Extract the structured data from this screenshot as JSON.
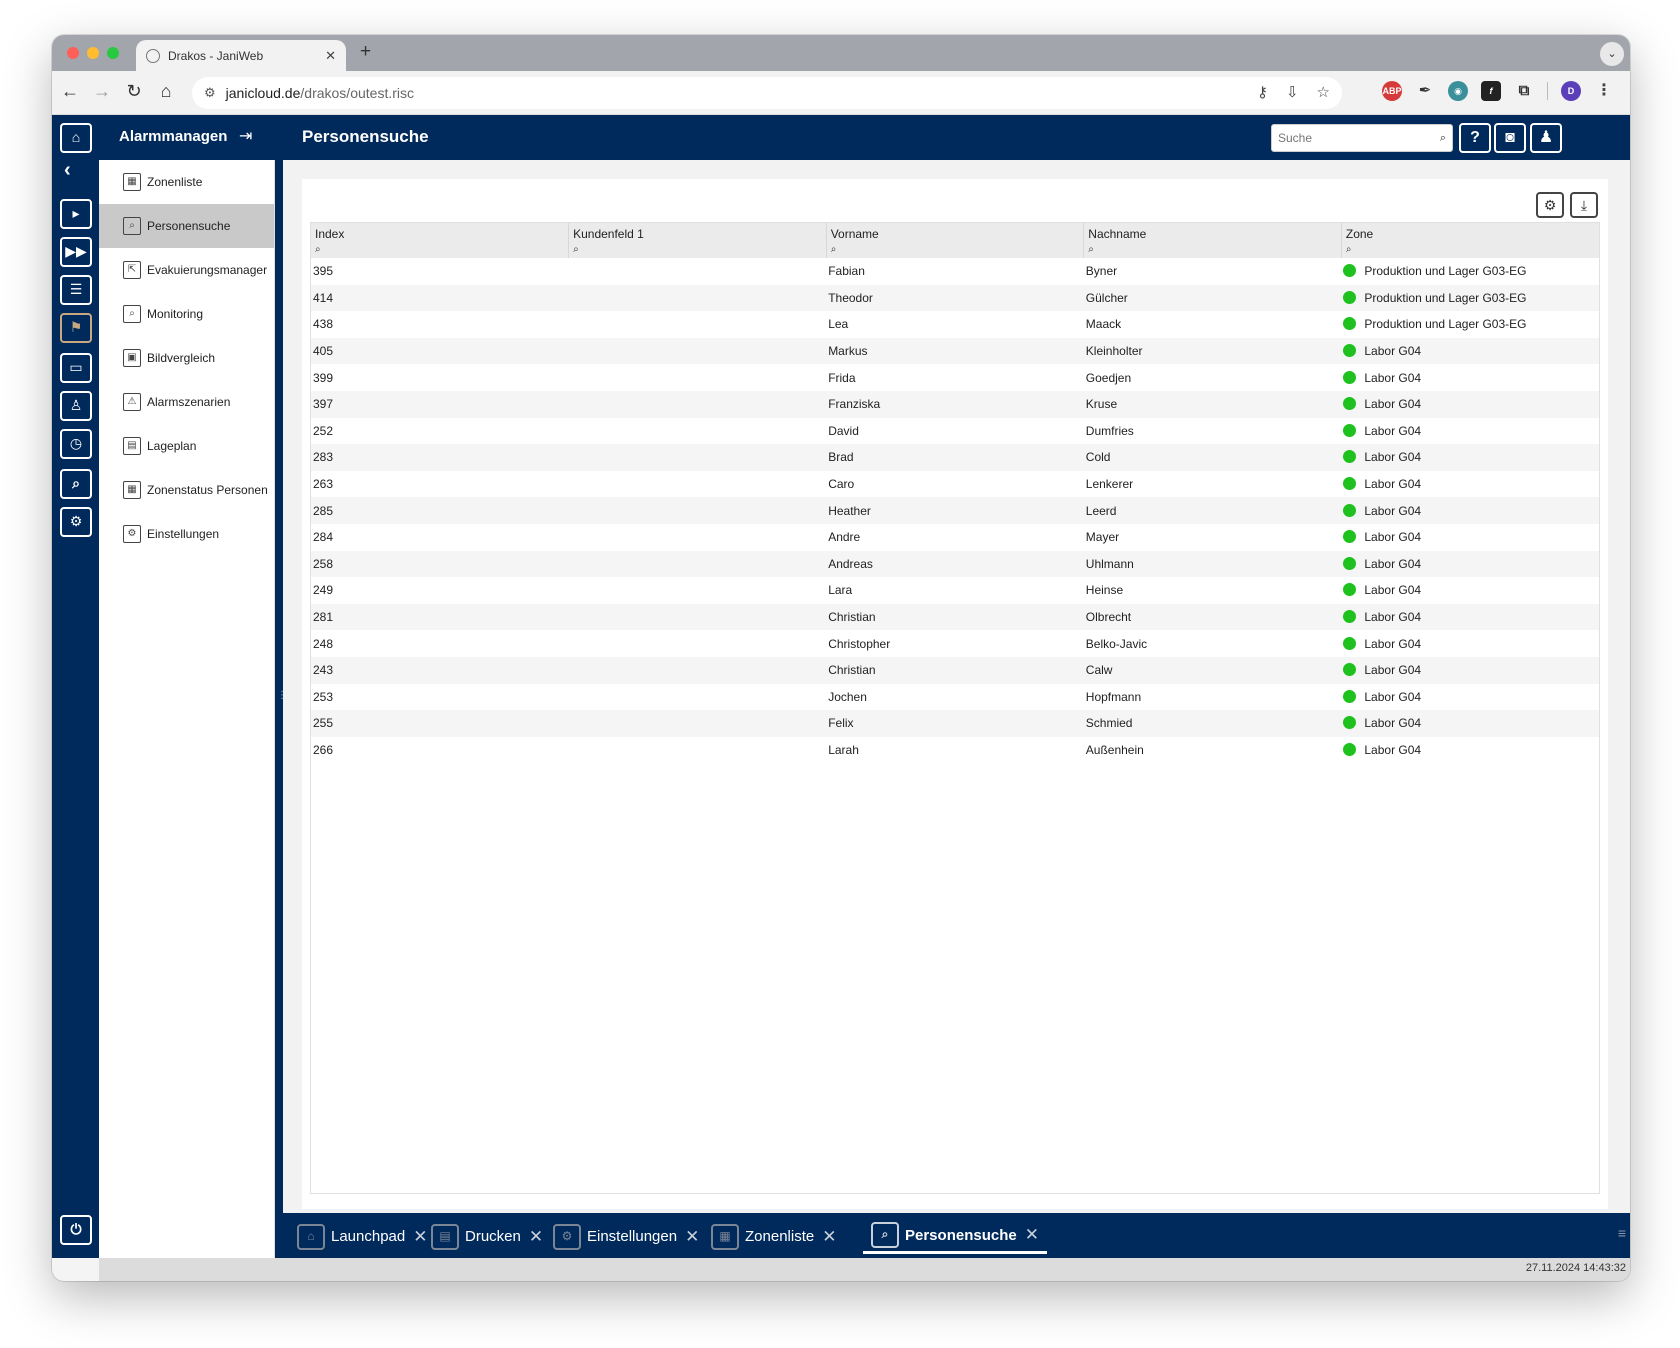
{
  "browser": {
    "tab_title": "Drakos - JaniWeb",
    "url_host": "janicloud.de",
    "url_path": "/drakos/outest.risc",
    "colors": {
      "tabstrip": "#a3a5ad",
      "toolbar": "#f2f2f2"
    }
  },
  "app": {
    "module_title": "Alarmmanagen",
    "page_title": "Personensuche",
    "search_placeholder": "Suche",
    "colors": {
      "primary": "#002a5c",
      "status_green": "#1fc11f",
      "active_row": "#c9c9c9"
    }
  },
  "submenu": {
    "items": [
      {
        "label": "Zonenliste",
        "icon": "grid-icon"
      },
      {
        "label": "Personensuche",
        "icon": "person-search-icon"
      },
      {
        "label": "Evakuierungsmanager",
        "icon": "evacuation-icon"
      },
      {
        "label": "Monitoring",
        "icon": "monitoring-icon"
      },
      {
        "label": "Bildvergleich",
        "icon": "image-compare-icon"
      },
      {
        "label": "Alarmszenarien",
        "icon": "warning-icon"
      },
      {
        "label": "Lageplan",
        "icon": "map-icon"
      },
      {
        "label": "Zonenstatus Personen",
        "icon": "grid-icon"
      },
      {
        "label": "Einstellungen",
        "icon": "gear-icon"
      }
    ]
  },
  "table": {
    "columns": [
      "Index",
      "Kundenfeld 1",
      "Vorname",
      "Nachname",
      "Zone"
    ],
    "rows": [
      {
        "index": "395",
        "kundenfeld": "",
        "vorname": "Fabian",
        "nachname": "Byner",
        "zone": "Produktion und Lager G03-EG"
      },
      {
        "index": "414",
        "kundenfeld": "",
        "vorname": "Theodor",
        "nachname": "Gülcher",
        "zone": "Produktion und Lager G03-EG"
      },
      {
        "index": "438",
        "kundenfeld": "",
        "vorname": "Lea",
        "nachname": "Maack",
        "zone": "Produktion und Lager G03-EG"
      },
      {
        "index": "405",
        "kundenfeld": "",
        "vorname": "Markus",
        "nachname": "Kleinholter",
        "zone": "Labor G04"
      },
      {
        "index": "399",
        "kundenfeld": "",
        "vorname": "Frida",
        "nachname": "Goedjen",
        "zone": "Labor G04"
      },
      {
        "index": "397",
        "kundenfeld": "",
        "vorname": "Franziska",
        "nachname": "Kruse",
        "zone": "Labor G04"
      },
      {
        "index": "252",
        "kundenfeld": "",
        "vorname": "David",
        "nachname": "Dumfries",
        "zone": "Labor G04"
      },
      {
        "index": "283",
        "kundenfeld": "",
        "vorname": "Brad",
        "nachname": "Cold",
        "zone": "Labor G04"
      },
      {
        "index": "263",
        "kundenfeld": "",
        "vorname": "Caro",
        "nachname": "Lenkerer",
        "zone": "Labor G04"
      },
      {
        "index": "285",
        "kundenfeld": "",
        "vorname": "Heather",
        "nachname": "Leerd",
        "zone": "Labor G04"
      },
      {
        "index": "284",
        "kundenfeld": "",
        "vorname": "Andre",
        "nachname": "Mayer",
        "zone": "Labor G04"
      },
      {
        "index": "258",
        "kundenfeld": "",
        "vorname": "Andreas",
        "nachname": "Uhlmann",
        "zone": "Labor G04"
      },
      {
        "index": "249",
        "kundenfeld": "",
        "vorname": "Lara",
        "nachname": "Heinse",
        "zone": "Labor G04"
      },
      {
        "index": "281",
        "kundenfeld": "",
        "vorname": "Christian",
        "nachname": "Olbrecht",
        "zone": "Labor G04"
      },
      {
        "index": "248",
        "kundenfeld": "",
        "vorname": "Christopher",
        "nachname": "Belko-Javic",
        "zone": "Labor G04"
      },
      {
        "index": "243",
        "kundenfeld": "",
        "vorname": "Christian",
        "nachname": "Calw",
        "zone": "Labor G04"
      },
      {
        "index": "253",
        "kundenfeld": "",
        "vorname": "Jochen",
        "nachname": "Hopfmann",
        "zone": "Labor G04"
      },
      {
        "index": "255",
        "kundenfeld": "",
        "vorname": "Felix",
        "nachname": "Schmied",
        "zone": "Labor G04"
      },
      {
        "index": "266",
        "kundenfeld": "",
        "vorname": "Larah",
        "nachname": "Außenhein",
        "zone": "Labor G04"
      }
    ]
  },
  "bottom_tabs": [
    {
      "label": "Launchpad",
      "icon": "home-icon",
      "active": false
    },
    {
      "label": "Drucken",
      "icon": "print-icon",
      "active": false
    },
    {
      "label": "Einstellungen",
      "icon": "gear-icon",
      "active": false
    },
    {
      "label": "Zonenliste",
      "icon": "grid-icon",
      "active": false
    },
    {
      "label": "Personensuche",
      "icon": "person-search-icon",
      "active": true
    }
  ],
  "status": {
    "datetime": "27.11.2024 14:43:32"
  }
}
